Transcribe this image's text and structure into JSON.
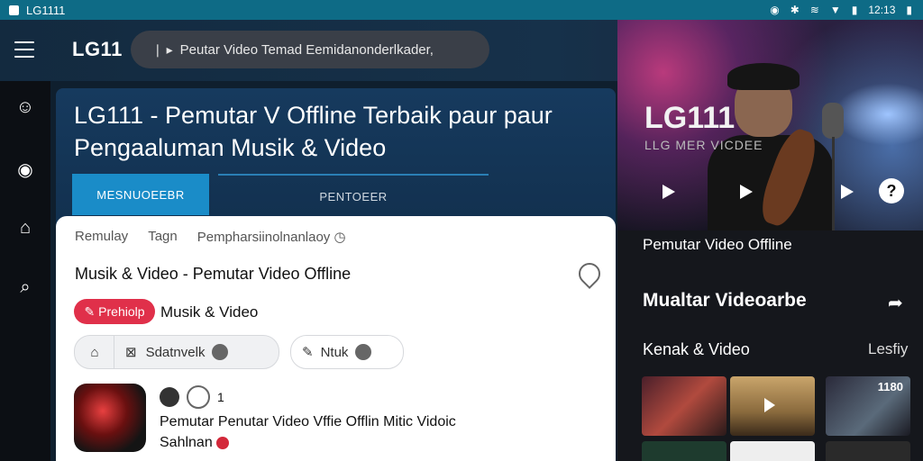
{
  "status_bar": {
    "app_label": "LG1111",
    "time": "12:13"
  },
  "app_bar": {
    "title": "LG11",
    "search_text": "Peutar Video Temad Eemidanonderlkader,"
  },
  "hero": {
    "title": "LG111",
    "subtitle": "LLG MER VICDEE"
  },
  "main": {
    "title": "LG111 - Pemutar V Offline Terbaik paur paur Pengaaluman Musik & Video",
    "tabs": [
      {
        "label": "MESNUOEEBR"
      },
      {
        "label": "PENTOEER"
      }
    ]
  },
  "card": {
    "subtabs": [
      "Remulay",
      "Tagn",
      "Pempharsiinolnanlaoy"
    ],
    "heading": "Musik & Video - Pemutar Video Offline",
    "pill_label": "Prehiolp",
    "pill_text": "Musik & Video",
    "chip_a": "Sdatnvelk",
    "chip_b": "Ntuk",
    "counter": "1",
    "media_title": "Pemutar  Penutar Video Vffie Offlin Mitic Vidoic",
    "media_sub": "Sahlnan"
  },
  "side": {
    "label1": "Pemutar Video Offline",
    "label2": "Mualtar Videoarbe",
    "label3": "Kenak & Video",
    "label3b": "Lesfiy",
    "grid_badge": "1180"
  },
  "colors": {
    "accent": "#1a8cc8",
    "status_bar": "#0e6b86",
    "red": "#e0304a"
  }
}
